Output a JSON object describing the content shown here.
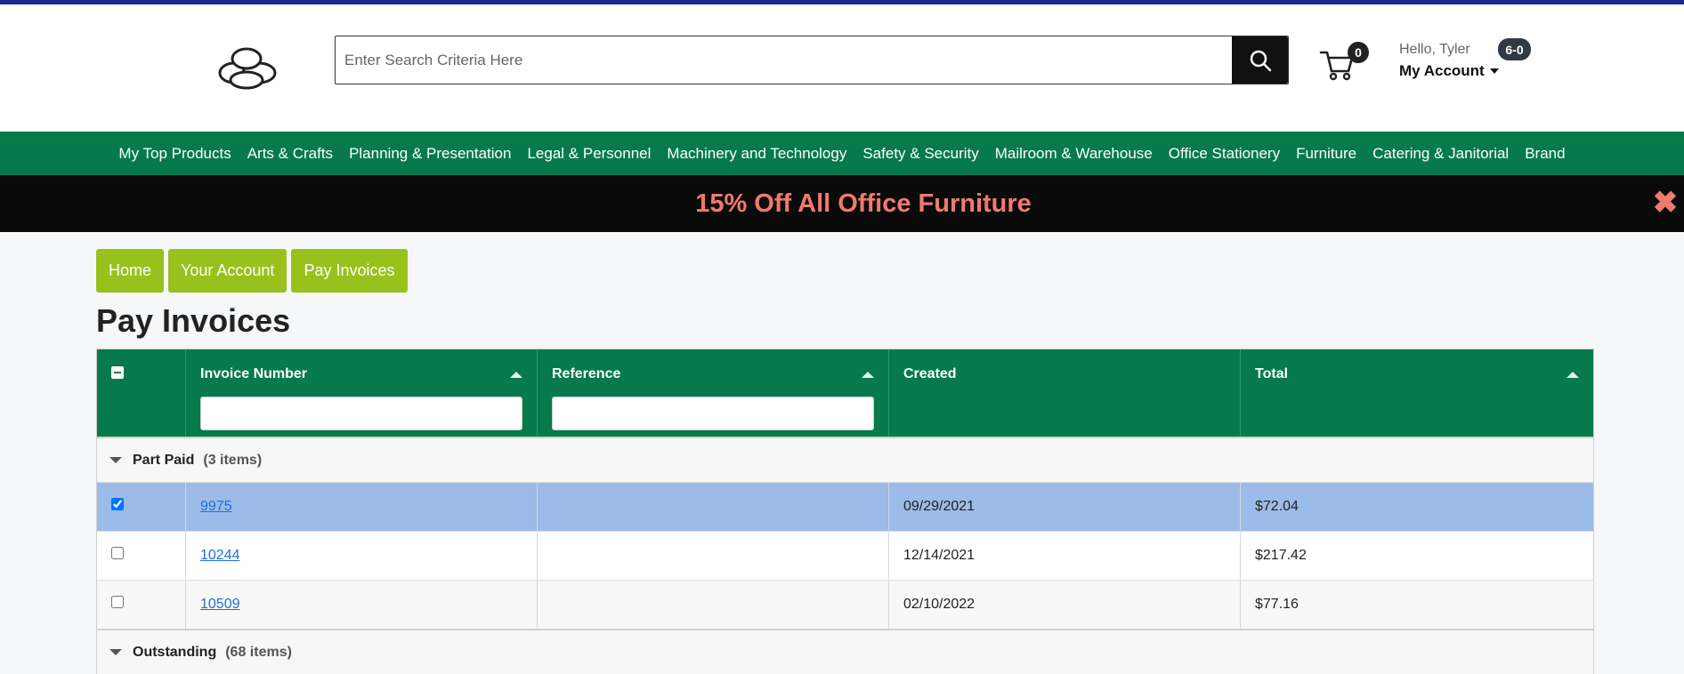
{
  "header": {
    "search_placeholder": "Enter Search Criteria Here",
    "cart_count": "0",
    "greeting": "Hello, Tyler",
    "account_label": "My Account",
    "account_badge": "6-0"
  },
  "nav": {
    "items": [
      "My Top Products",
      "Arts & Crafts",
      "Planning & Presentation",
      "Legal & Personnel",
      "Machinery and Technology",
      "Safety & Security",
      "Mailroom & Warehouse",
      "Office Stationery",
      "Furniture",
      "Catering & Janitorial",
      "Brand"
    ]
  },
  "promo": {
    "text": "15% Off All Office Furniture"
  },
  "breadcrumbs": [
    "Home",
    "Your Account",
    "Pay Invoices"
  ],
  "page": {
    "title": "Pay Invoices"
  },
  "table": {
    "columns": {
      "invoice_number": "Invoice Number",
      "reference": "Reference",
      "created": "Created",
      "total": "Total"
    },
    "groups": [
      {
        "name": "Part Paid",
        "count": "(3 items)",
        "rows": [
          {
            "checked": true,
            "invoice": "9975",
            "reference": "",
            "created": "09/29/2021",
            "total": "$72.04"
          },
          {
            "checked": false,
            "invoice": "10244",
            "reference": "",
            "created": "12/14/2021",
            "total": "$217.42"
          },
          {
            "checked": false,
            "invoice": "10509",
            "reference": "",
            "created": "02/10/2022",
            "total": "$77.16"
          }
        ]
      },
      {
        "name": "Outstanding",
        "count": "(68 items)"
      }
    ]
  },
  "colors": {
    "top_bar": "#1b2a8c",
    "nav_green": "#067a4b",
    "breadcrumb_lime": "#99c11c",
    "promo_text": "#f07a6e",
    "selected_row": "#9bbbe8",
    "link": "#1c6fd6"
  },
  "icons": {
    "logo": "cloud-logo-icon",
    "search": "search-icon",
    "cart": "cart-icon",
    "close": "close-icon",
    "sort": "sort-asc-icon",
    "group_toggle": "caret-down-icon"
  }
}
